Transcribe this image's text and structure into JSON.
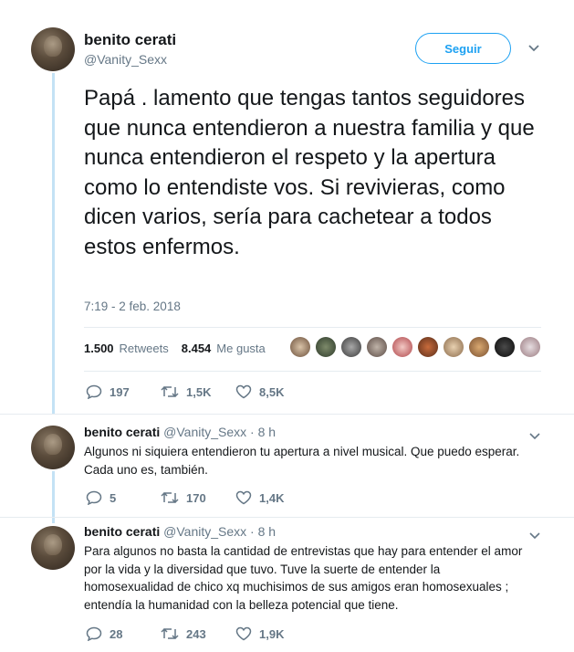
{
  "tweet": {
    "author_name": "benito cerati",
    "author_handle": "@Vanity_Sexx",
    "follow_label": "Seguir",
    "text": "Papá . lamento que tengas tantos seguidores que nunca entendieron a nuestra familia y que nunca entendieron el respeto y la apertura como lo entendiste vos. Si revivieras, como dicen varios, sería para cachetear a todos estos enfermos.",
    "timestamp": "7:19 - 2 feb. 2018",
    "retweets_count": "1.500",
    "retweets_label": "Retweets",
    "likes_count": "8.454",
    "likes_label": "Me gusta",
    "reply_count": "197",
    "retweet_action_count": "1,5K",
    "like_action_count": "8,5K"
  },
  "replies": [
    {
      "author_name": "benito cerati",
      "meta": "@Vanity_Sexx · 8 h",
      "line1": "Algunos ni siquiera entendieron tu apertura a nivel musical. Que puedo esperar.",
      "line2": "Cada uno es, también.",
      "reply_count": "5",
      "retweet_count": "170",
      "like_count": "1,4K"
    },
    {
      "author_name": "benito cerati",
      "meta": "@Vanity_Sexx · 8 h",
      "line1": "Para algunos no basta la cantidad de entrevistas que hay para entender el amor",
      "line2": "por la vida y la diversidad que tuvo. Tuve la suerte de entender la",
      "line3": "homosexualidad de chico xq muchisimos de sus amigos eran homosexuales ;",
      "line4": "entendía la humanidad con la belleza potencial que tiene.",
      "reply_count": "28",
      "retweet_count": "243",
      "like_count": "1,9K"
    }
  ],
  "colors": {
    "accent": "#1da1f2",
    "muted": "#657786",
    "thread": "#c4e2f5"
  }
}
